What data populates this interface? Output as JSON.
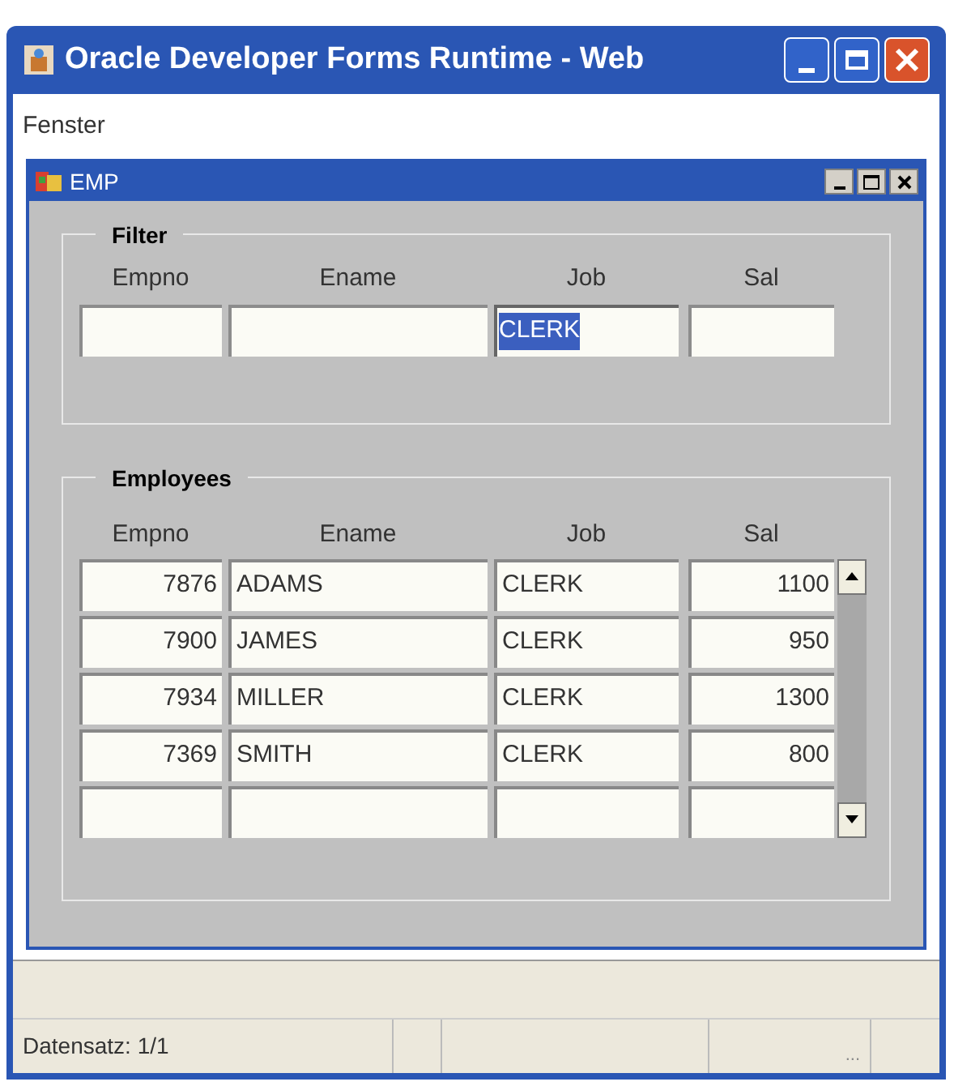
{
  "window": {
    "title": "Oracle Developer Forms Runtime - Web"
  },
  "menu": [
    "Fenster"
  ],
  "form_window": {
    "title": "EMP"
  },
  "filter": {
    "title": "Filter",
    "fields": [
      {
        "label": "Empno",
        "selected": false
      },
      {
        "label": "Ename",
        "selected": false
      },
      {
        "label": "Job",
        "value": "CLERK",
        "selected": true
      },
      {
        "label": "Sal",
        "selected": false
      }
    ]
  },
  "employees": {
    "title": "Employees",
    "columns": [
      "Empno",
      "Ename",
      "Job",
      "Sal"
    ],
    "rows": [
      [
        "7876",
        "ADAMS",
        "CLERK",
        "1100"
      ],
      [
        "7900",
        "JAMES",
        "CLERK",
        "950"
      ],
      [
        "7934",
        "MILLER",
        "CLERK",
        "1300"
      ],
      [
        "7369",
        "SMITH",
        "CLERK",
        "800"
      ]
    ]
  },
  "status_bar": {
    "record": "Datensatz: 1/1",
    "indicator": "..."
  }
}
